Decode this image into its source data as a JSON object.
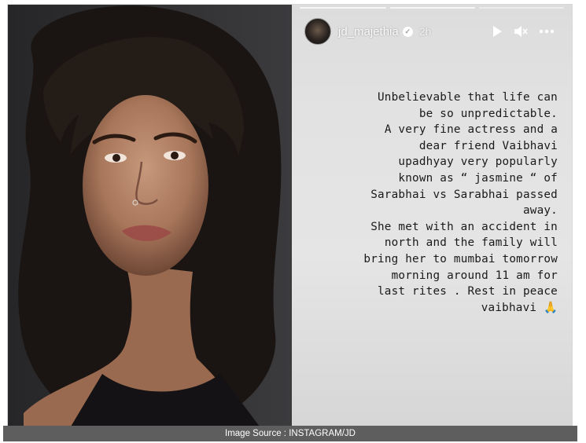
{
  "story": {
    "username": "jd_majethia",
    "time": "2h",
    "text": "Unbelievable that life can\nbe so unpredictable.\nA very fine actress and a\ndear friend Vaibhavi\nupadhyay very popularly\nknown as “ jasmine “ of\nSarabhai vs Sarabhai passed\naway.\nShe met with an accident in\nnorth and the family will\nbring her to mumbai tomorrow\nmorning around 11 am for\nlast rites . Rest in peace\nvaibhavi 🙏",
    "controls": {
      "play_icon": "play-icon",
      "mute_icon": "mute-icon",
      "more_icon": "more-icon"
    }
  },
  "photo": {
    "subject": "portrait-photo"
  },
  "caption": "Image Source : INSTAGRAM/JD"
}
